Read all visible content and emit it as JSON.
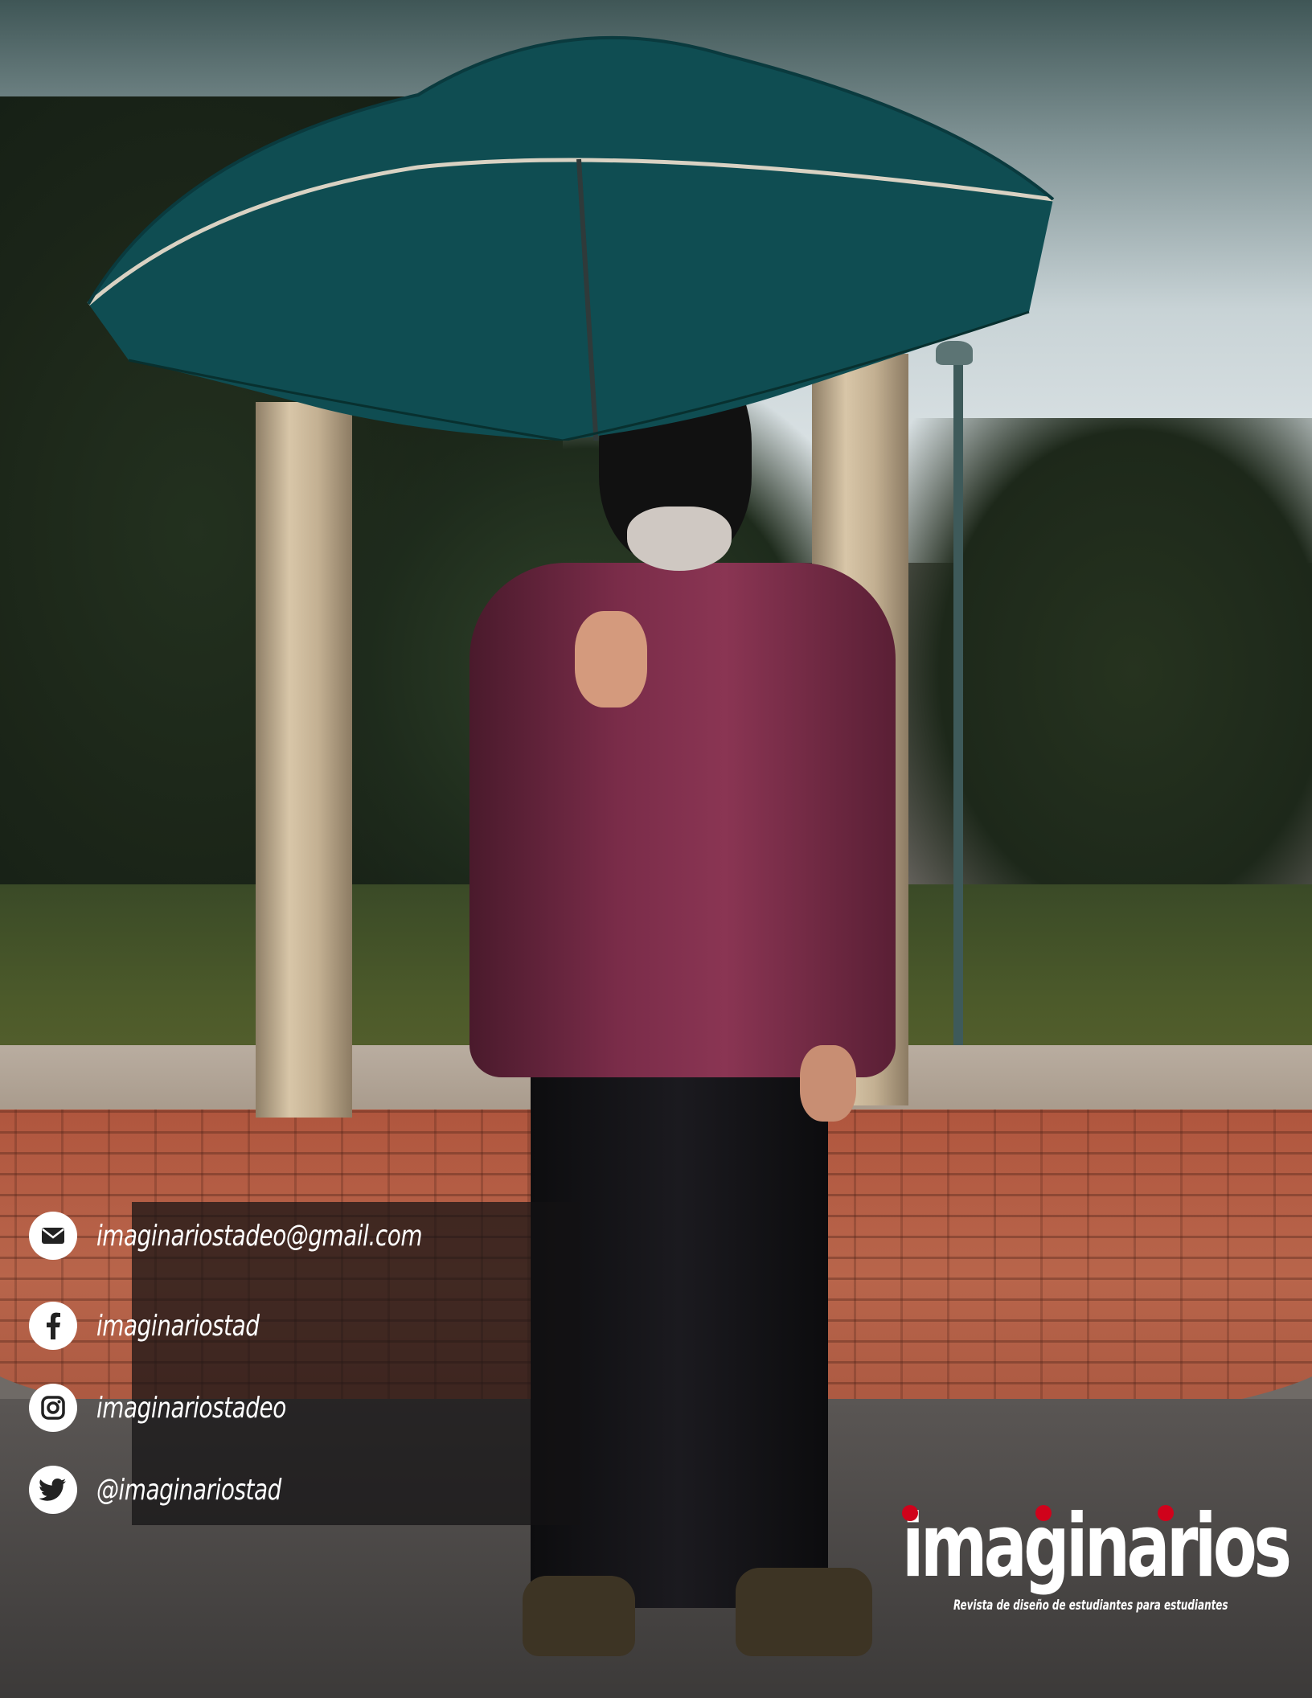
{
  "contact": {
    "email": "imaginariostadeo@gmail.com",
    "facebook": "imaginariostad",
    "instagram": "imaginariostadeo",
    "twitter": "@imaginariostad"
  },
  "brand": {
    "name": "imaginarios",
    "tagline": "Revista de diseño de estudiantes para estudiantes",
    "accent_color": "#d0021b",
    "text_color": "#ffffff"
  },
  "icons": {
    "email": "envelope-icon",
    "facebook": "facebook-icon",
    "instagram": "instagram-icon",
    "twitter": "twitter-bird-icon"
  },
  "colors": {
    "panel_background": "rgba(20, 18, 20, 0.72)",
    "umbrella": "#0f4d52",
    "jacket": "#7a2c49"
  }
}
